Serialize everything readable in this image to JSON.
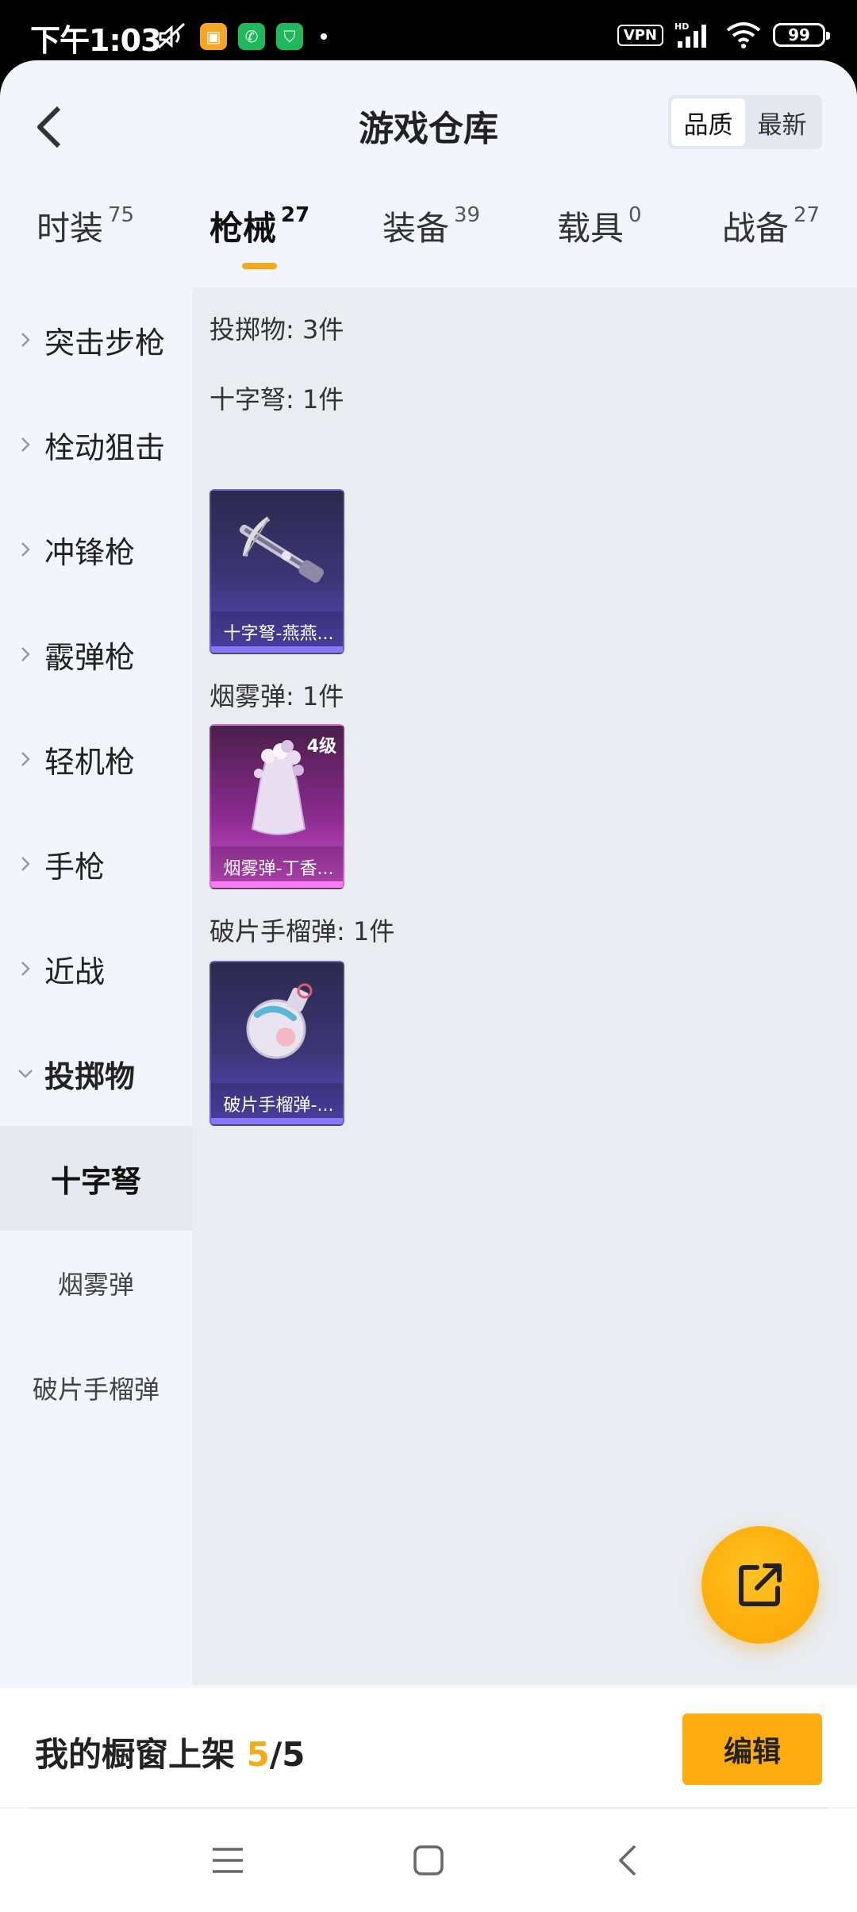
{
  "status_bar": {
    "time": "下午1:03",
    "vpn": "VPN",
    "network": "HD",
    "battery": "99"
  },
  "header": {
    "title": "游戏仓库",
    "sort_options": [
      "品质",
      "最新"
    ],
    "sort_selected": "品质"
  },
  "tabs": [
    {
      "label": "时装",
      "count": "75"
    },
    {
      "label": "枪械",
      "count": "27",
      "active": true
    },
    {
      "label": "装备",
      "count": "39"
    },
    {
      "label": "载具",
      "count": "0"
    },
    {
      "label": "战备",
      "count": "27"
    }
  ],
  "sidebar": {
    "items": [
      {
        "label": "突击步枪"
      },
      {
        "label": "栓动狙击"
      },
      {
        "label": "冲锋枪"
      },
      {
        "label": "霰弹枪"
      },
      {
        "label": "轻机枪"
      },
      {
        "label": "手枪"
      },
      {
        "label": "近战"
      },
      {
        "label": "投掷物",
        "expanded": true
      }
    ],
    "subitems": [
      {
        "label": "十字弩",
        "active": true
      },
      {
        "label": "烟雾弹"
      },
      {
        "label": "破片手榴弹"
      }
    ]
  },
  "content": {
    "summary": "投掷物: 3件",
    "sections": [
      {
        "label": "十字弩: 1件",
        "card": {
          "name": "十字弩-燕燕...",
          "rarity": "purple",
          "icon": "crossbow-icon"
        }
      },
      {
        "label": "烟雾弹: 1件",
        "card": {
          "name": "烟雾弹-丁香...",
          "rarity": "pink",
          "level": "4级",
          "icon": "smoke-grenade-icon"
        }
      },
      {
        "label": "破片手榴弹: 1件",
        "card": {
          "name": "破片手榴弹-...",
          "rarity": "purple",
          "icon": "frag-grenade-icon"
        }
      }
    ]
  },
  "bottom": {
    "showcase_label": "我的橱窗上架",
    "showcase_current": "5",
    "showcase_sep": "/",
    "showcase_total": "5",
    "edit_label": "编辑"
  },
  "colors": {
    "accent": "#f7a71a",
    "fab": "#ffab0a",
    "purple_rarity": "#8c76ff",
    "pink_rarity": "#ff7df5"
  }
}
